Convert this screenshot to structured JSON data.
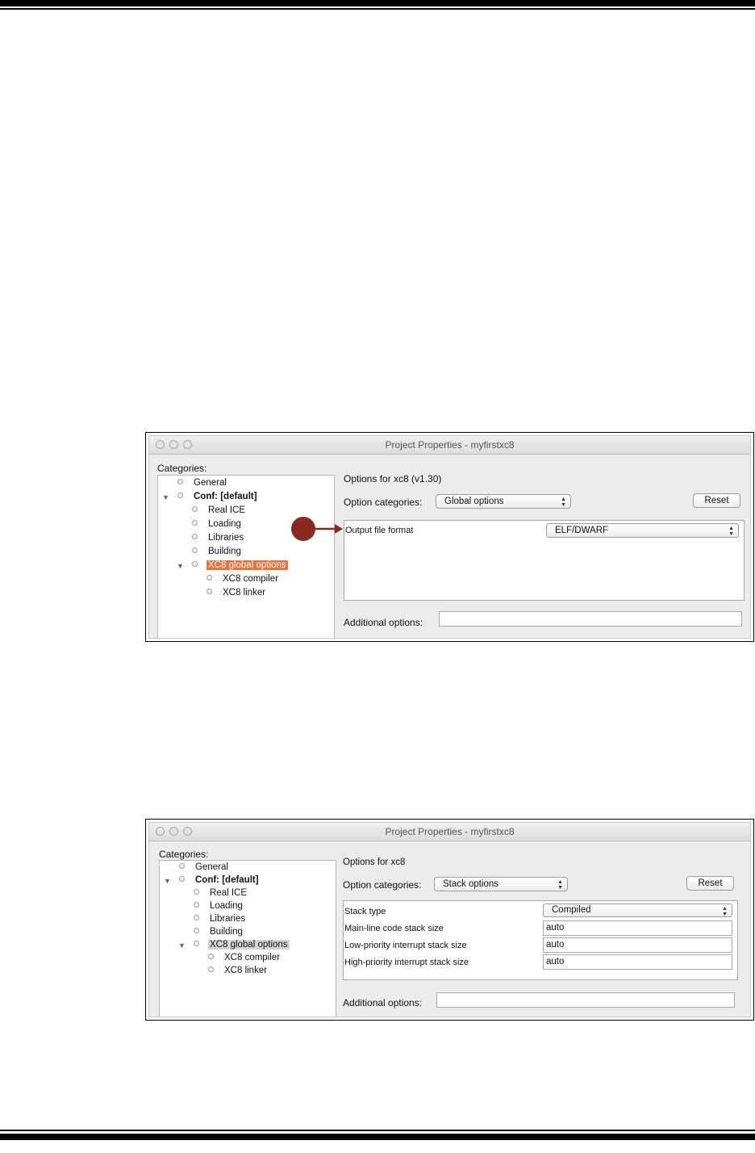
{
  "figure1": {
    "window_title": "Project Properties - myfirstxc8",
    "categories_label": "Categories:",
    "tree": [
      {
        "label": "General"
      },
      {
        "label": "Conf: [default]"
      },
      {
        "label": "Real ICE"
      },
      {
        "label": "Loading"
      },
      {
        "label": "Libraries"
      },
      {
        "label": "Building"
      },
      {
        "label": "XC8 global options"
      },
      {
        "label": "XC8 compiler"
      },
      {
        "label": "XC8 linker"
      }
    ],
    "options_header": "Options for xc8 (v1.30)",
    "option_categories_label": "Option categories:",
    "option_categories_value": "Global options",
    "reset_label": "Reset",
    "properties": [
      {
        "label": "Output file format",
        "value": "ELF/DWARF"
      }
    ],
    "additional_options_label": "Additional options:",
    "additional_options_value": ""
  },
  "figure2": {
    "window_title": "Project Properties - myfirstxc8",
    "categories_label": "Categories:",
    "tree": [
      {
        "label": "General"
      },
      {
        "label": "Conf: [default]"
      },
      {
        "label": "Real ICE"
      },
      {
        "label": "Loading"
      },
      {
        "label": "Libraries"
      },
      {
        "label": "Building"
      },
      {
        "label": "XC8 global options"
      },
      {
        "label": "XC8 compiler"
      },
      {
        "label": "XC8 linker"
      }
    ],
    "options_header": "Options for xc8",
    "option_categories_label": "Option categories:",
    "option_categories_value": "Stack options",
    "reset_label": "Reset",
    "properties": [
      {
        "label": "Stack type",
        "value": "Compiled"
      },
      {
        "label": "Main-line code stack size",
        "value": "auto"
      },
      {
        "label": "Low-priority interrupt stack size",
        "value": "auto"
      },
      {
        "label": "High-priority interrupt stack size",
        "value": "auto"
      }
    ],
    "additional_options_label": "Additional options:",
    "additional_options_value": ""
  },
  "colors": {
    "selection_orange": "#e8743b",
    "selection_gray": "#d4d4d4",
    "callout_marker": "#8a2a1e"
  },
  "icons": [
    "close-light",
    "minimize-light",
    "zoom-light",
    "expand-triangle-icon",
    "tree-bullet-icon",
    "updown-arrows-icon",
    "callout-arrow-icon"
  ]
}
